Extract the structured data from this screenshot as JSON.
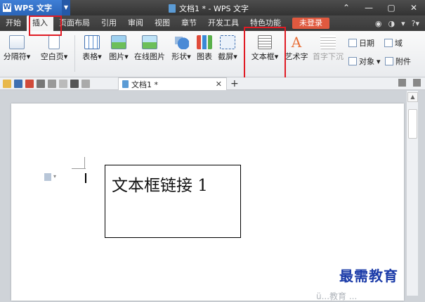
{
  "app": {
    "name": "WPS 文字",
    "logo_letter": "W",
    "caret": "▼"
  },
  "window": {
    "title": "文档1 * - WPS 文字",
    "controls": [
      "⌃",
      "—",
      "▢",
      "✕"
    ]
  },
  "menu": {
    "tabs": [
      "开始",
      "插入",
      "页面布局",
      "引用",
      "审阅",
      "视图",
      "章节",
      "开发工具",
      "特色功能"
    ],
    "active_tab": "插入",
    "login_label": "未登录",
    "right_icons": [
      "◉",
      "◑",
      "▾",
      "?▾"
    ]
  },
  "ribbon": {
    "page_break": "分隔符",
    "blank_page": "空白页",
    "table": "表格",
    "picture": "图片",
    "online_picture": "在线图片",
    "shapes": "形状",
    "chart": "图表",
    "screenshot": "截屏",
    "textbox": "文本框",
    "wordart": "艺术字",
    "dropcap": "首字下沉",
    "date": "日期",
    "object": "对象",
    "field": "域",
    "attachment": "附件",
    "dropdown_caret": "▾"
  },
  "doc_tabs": {
    "active": "文档1 *",
    "close": "✕",
    "add": "+"
  },
  "document": {
    "textbox_text": "文本框链接 1"
  },
  "watermark": {
    "text": "最需教育",
    "sub": "ü...教育 ..."
  },
  "colors": {
    "accent": "#2a64b8",
    "highlight": "#e01b24",
    "login": "#e0593f"
  }
}
